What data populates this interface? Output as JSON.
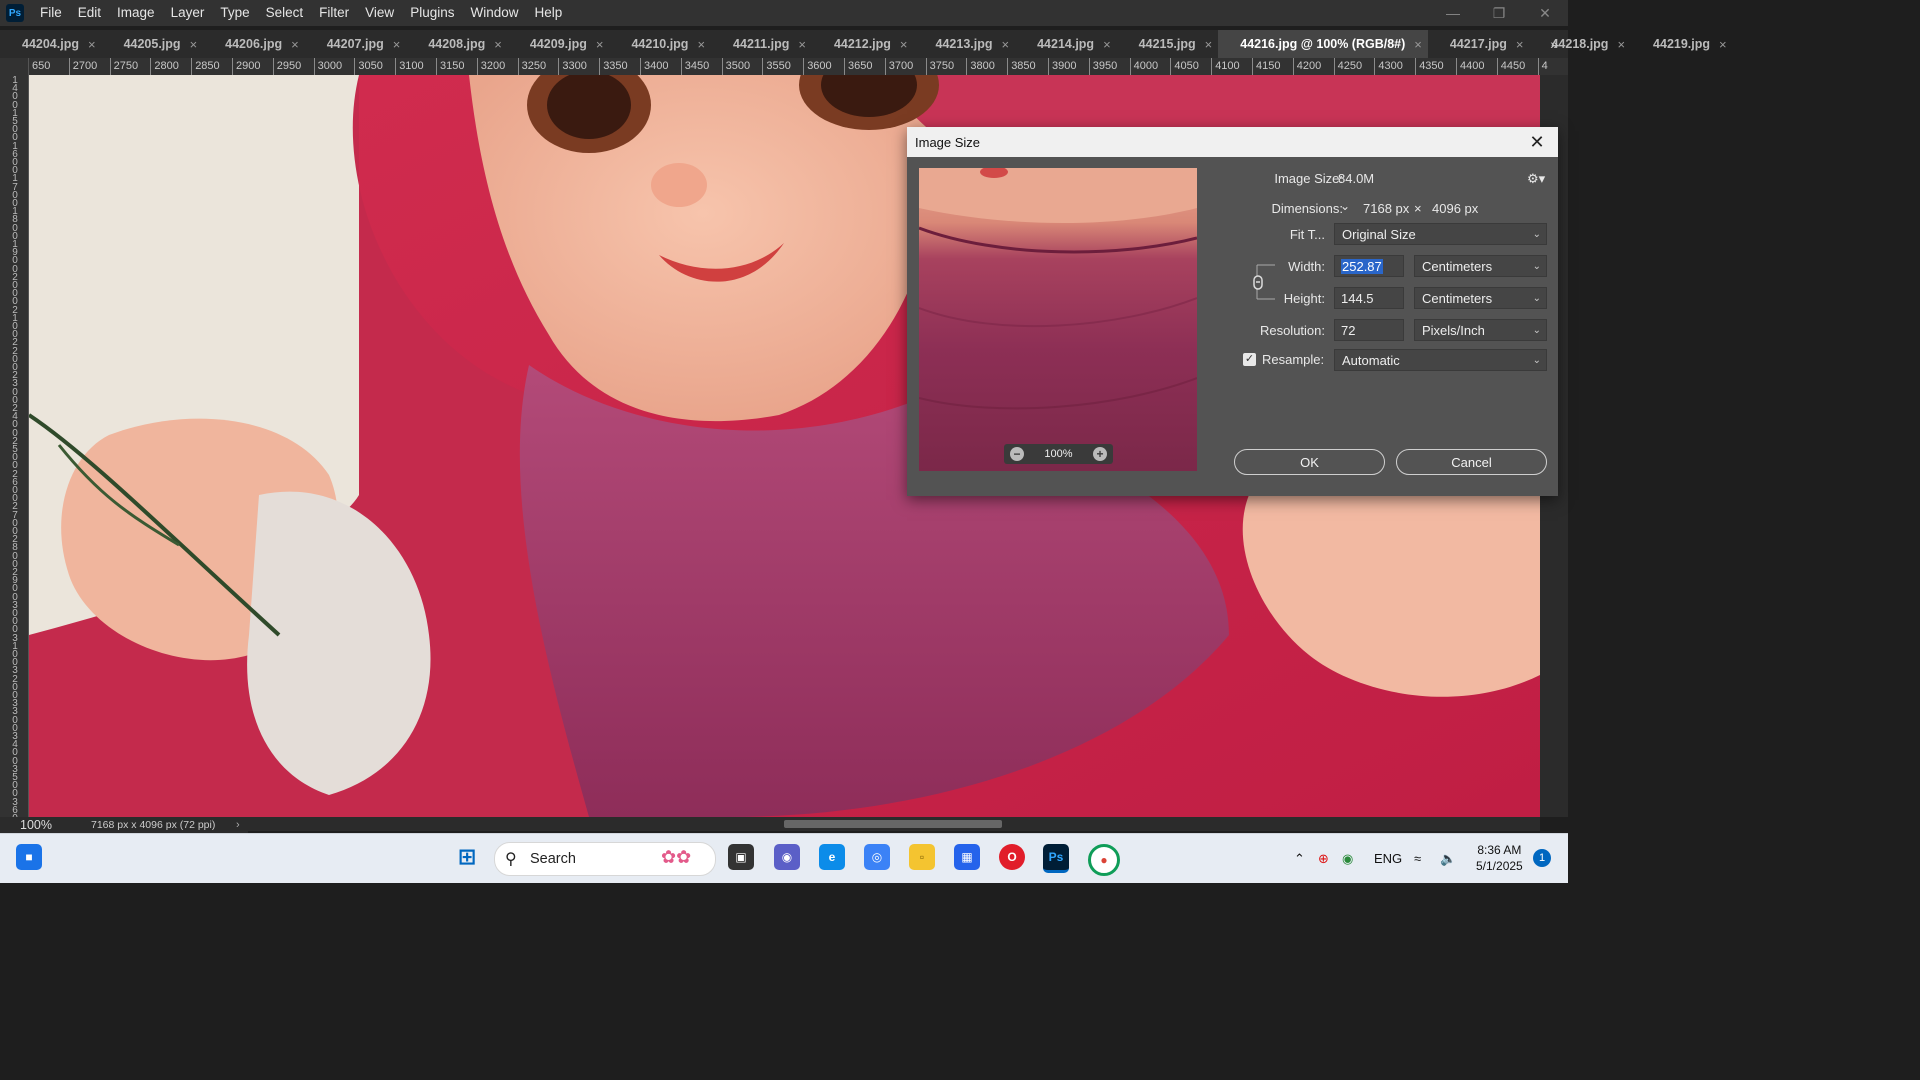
{
  "app": {
    "logo": "Ps"
  },
  "menu": [
    "File",
    "Edit",
    "Image",
    "Layer",
    "Type",
    "Select",
    "Filter",
    "View",
    "Plugins",
    "Window",
    "Help"
  ],
  "tabs": [
    {
      "label": "44204.jpg",
      "active": false
    },
    {
      "label": "44205.jpg",
      "active": false
    },
    {
      "label": "44206.jpg",
      "active": false
    },
    {
      "label": "44207.jpg",
      "active": false
    },
    {
      "label": "44208.jpg",
      "active": false
    },
    {
      "label": "44209.jpg",
      "active": false
    },
    {
      "label": "44210.jpg",
      "active": false
    },
    {
      "label": "44211.jpg",
      "active": false
    },
    {
      "label": "44212.jpg",
      "active": false
    },
    {
      "label": "44213.jpg",
      "active": false
    },
    {
      "label": "44214.jpg",
      "active": false
    },
    {
      "label": "44215.jpg",
      "active": false
    },
    {
      "label": "44216.jpg @ 100% (RGB/8#)",
      "active": true
    },
    {
      "label": "44217.jpg",
      "active": false
    },
    {
      "label": "44218.jpg",
      "active": false
    },
    {
      "label": "44219.jpg",
      "active": false
    }
  ],
  "tab_close": "×",
  "tab_overflow": "»",
  "ruler_h": [
    "650",
    "2700",
    "2750",
    "2800",
    "2850",
    "2900",
    "2950",
    "3000",
    "3050",
    "3100",
    "3150",
    "3200",
    "3250",
    "3300",
    "3350",
    "3400",
    "3450",
    "3500",
    "3550",
    "3600",
    "3650",
    "3700",
    "3750",
    "3800",
    "3850",
    "3900",
    "3950",
    "4000",
    "4050",
    "4100",
    "4150",
    "4200",
    "4250",
    "4300",
    "4350",
    "4400",
    "4450",
    "4"
  ],
  "ruler_v": [
    "1",
    "4",
    "0",
    "0",
    "1",
    "5",
    "0",
    "0",
    "1",
    "6",
    "0",
    "0",
    "1",
    "7",
    "0",
    "0",
    "1",
    "8",
    "0",
    "0",
    "1",
    "9",
    "0",
    "0",
    "2",
    "0",
    "0",
    "0",
    "2",
    "1",
    "0",
    "0",
    "2",
    "2",
    "0",
    "0",
    "2",
    "3",
    "0",
    "0",
    "2",
    "4",
    "0",
    "0",
    "2",
    "5",
    "0",
    "0",
    "2",
    "6",
    "0",
    "0",
    "2",
    "7",
    "0",
    "0",
    "2",
    "8",
    "0",
    "0",
    "2",
    "9",
    "0",
    "0",
    "3",
    "0",
    "0",
    "0",
    "3",
    "1",
    "0",
    "0",
    "3",
    "2",
    "0",
    "0",
    "3",
    "3",
    "0",
    "0",
    "3",
    "4",
    "0",
    "0",
    "3",
    "5",
    "0",
    "0",
    "3",
    "6",
    "0",
    "0"
  ],
  "status": {
    "zoom": "100%",
    "doc": "7168 px x 4096 px (72 ppi)",
    "arrow": "›"
  },
  "dialog": {
    "title": "Image Size",
    "close": "✕",
    "image_size_label": "Image Size:",
    "image_size_value": "84.0M",
    "dimensions_label": "Dimensions:",
    "dim_width": "7168 px",
    "dim_x": "×",
    "dim_height": "4096 px",
    "fit_label": "Fit T...",
    "fit_value": "Original Size",
    "width_label": "Width:",
    "width_value": "252.87",
    "width_unit": "Centimeters",
    "height_label": "Height:",
    "height_value": "144.5",
    "height_unit": "Centimeters",
    "resolution_label": "Resolution:",
    "resolution_value": "72",
    "resolution_unit": "Pixels/Inch",
    "resample_label": "Resample:",
    "resample_checked": true,
    "resample_value": "Automatic",
    "preview_zoom": "100%",
    "ok": "OK",
    "cancel": "Cancel"
  },
  "taskbar": {
    "search_label": "Search",
    "lang": "ENG",
    "time": "8:36 AM",
    "date": "5/1/2025",
    "notifications": "1"
  }
}
